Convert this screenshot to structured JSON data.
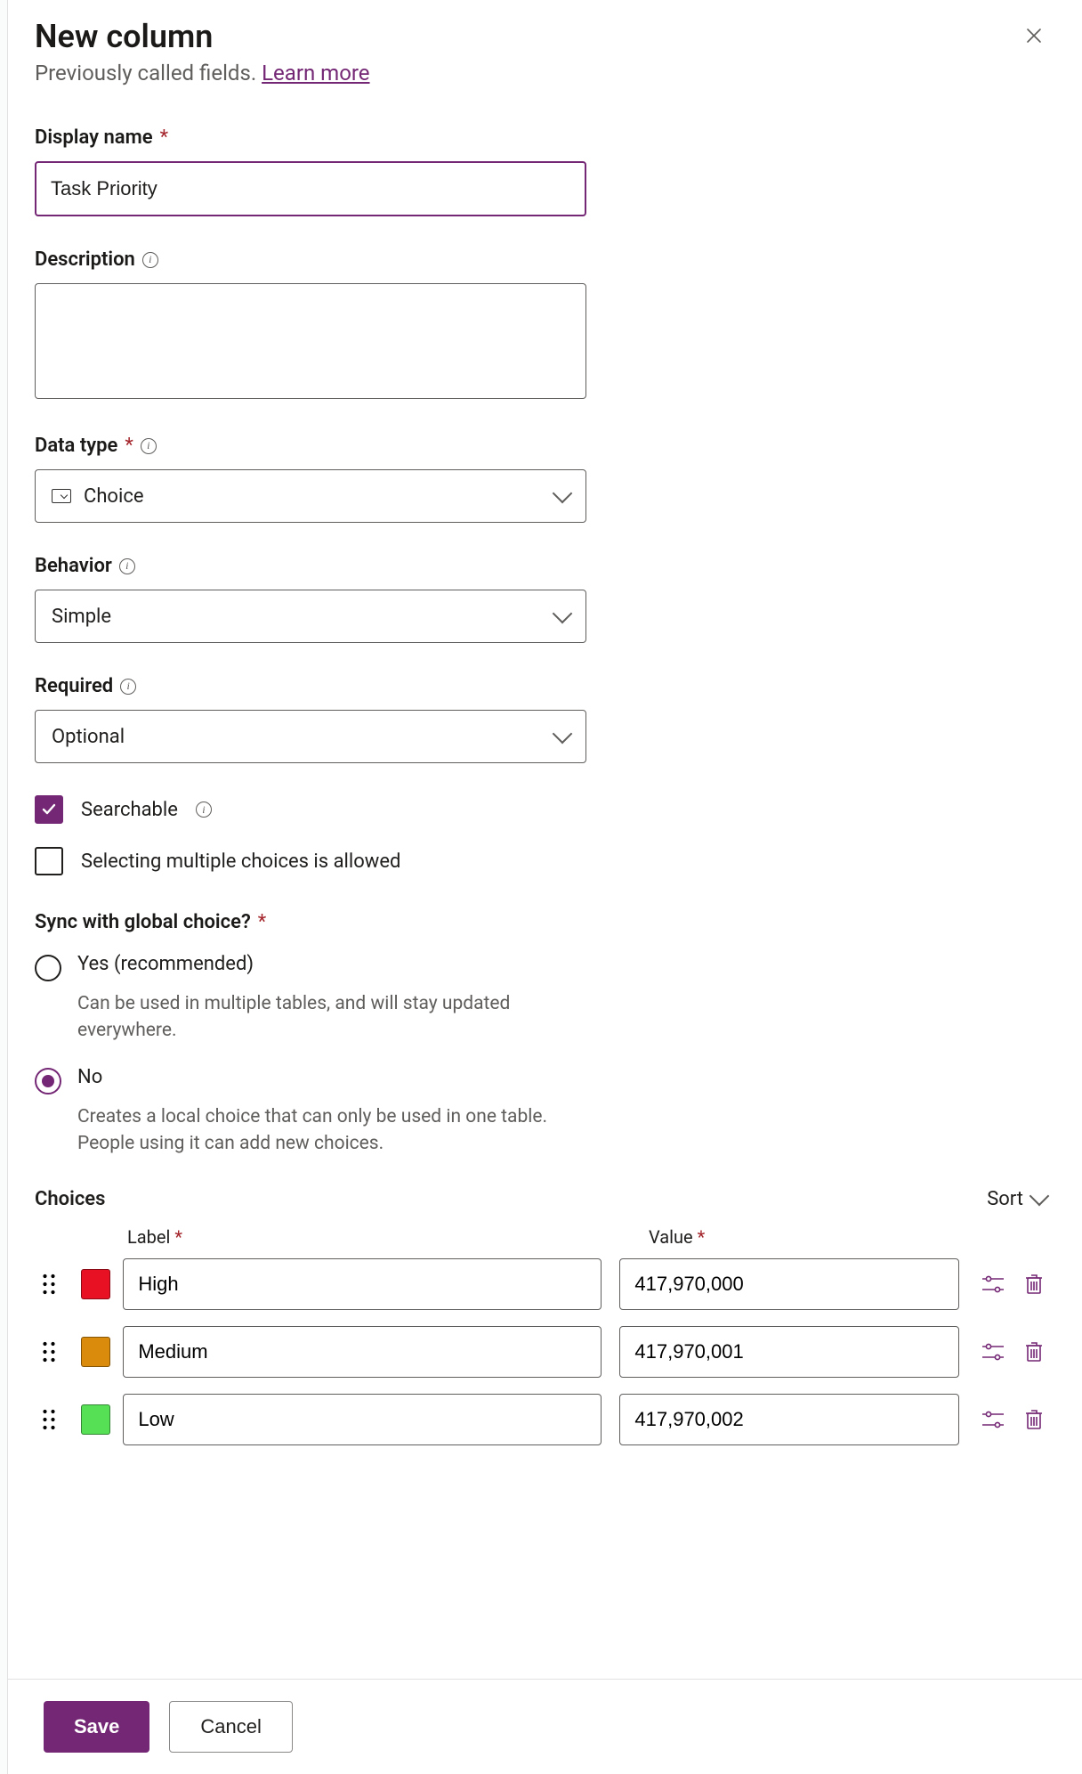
{
  "header": {
    "title": "New column",
    "subtitle_prefix": "Previously called fields. ",
    "learn_more": "Learn more"
  },
  "fields": {
    "display_name": {
      "label": "Display name",
      "value": "Task Priority"
    },
    "description": {
      "label": "Description",
      "value": ""
    },
    "data_type": {
      "label": "Data type",
      "value": "Choice"
    },
    "behavior": {
      "label": "Behavior",
      "value": "Simple"
    },
    "required": {
      "label": "Required",
      "value": "Optional"
    }
  },
  "checkboxes": {
    "searchable": {
      "label": "Searchable",
      "checked": true
    },
    "multi": {
      "label": "Selecting multiple choices is allowed",
      "checked": false
    }
  },
  "sync": {
    "question": "Sync with global choice?",
    "yes_label": "Yes (recommended)",
    "yes_desc": "Can be used in multiple tables, and will stay updated everywhere.",
    "no_label": "No",
    "no_desc": "Creates a local choice that can only be used in one table. People using it can add new choices.",
    "selected": "no"
  },
  "choices": {
    "title": "Choices",
    "sort_label": "Sort",
    "columns": {
      "label": "Label",
      "value": "Value"
    },
    "rows": [
      {
        "color": "#e81123",
        "label": "High",
        "value": "417,970,000"
      },
      {
        "color": "#da8b0b",
        "label": "Medium",
        "value": "417,970,001"
      },
      {
        "color": "#55e055",
        "label": "Low",
        "value": "417,970,002"
      }
    ]
  },
  "footer": {
    "save": "Save",
    "cancel": "Cancel"
  }
}
